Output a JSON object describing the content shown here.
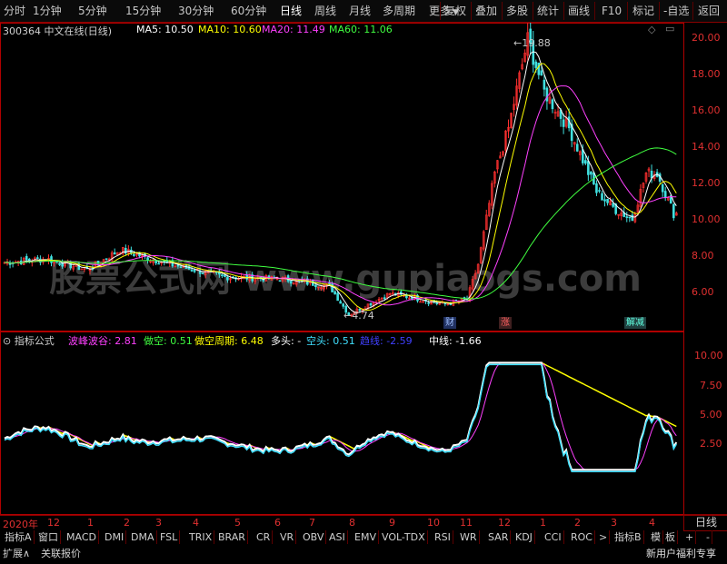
{
  "toolbar": {
    "periods": [
      "分时",
      "1分钟",
      "5分钟",
      "15分钟",
      "30分钟",
      "60分钟",
      "日线",
      "周线",
      "月线",
      "多周期",
      "更多"
    ],
    "active_period": "日线",
    "more_arrow": "▼",
    "actions": [
      "复权",
      "叠加",
      "多股",
      "统计",
      "画线",
      "F10",
      "标记",
      "-自选",
      "返回"
    ]
  },
  "main_header": {
    "stock": "300364 中文在线(日线)",
    "ma5": "MA5: 10.50",
    "ma10": "MA10: 10.60",
    "ma20": "MA20: 11.49",
    "ma60": "MA60: 11.06",
    "icons": [
      "diamond-icon",
      "menu-icon"
    ]
  },
  "main_yaxis": [
    "20.00",
    "18.00",
    "16.00",
    "14.00",
    "12.00",
    "10.00",
    "8.00",
    "6.00"
  ],
  "annotations": {
    "high": "19.88",
    "low": "4.74"
  },
  "event_marks": [
    "财",
    "涨",
    "解减"
  ],
  "watermark": "股票公式网 www.gupiaogs.com",
  "indicator_header": {
    "name": "指标公式",
    "bofeng": "波峰波谷: 2.81",
    "zuokong": "做空: 0.51",
    "zuokong_period": "做空周期: 6.48",
    "duotou": "多头: -",
    "kongtou": "空头: 0.51",
    "zhuixian": "趋线: -2.59",
    "zhongxian": "中线: -1.66"
  },
  "ind_yaxis": [
    "10.00",
    "7.50",
    "5.00",
    "2.50"
  ],
  "date_axis": {
    "start": "2020年",
    "ticks": [
      "12",
      "1",
      "2",
      "3",
      "4",
      "5",
      "6",
      "7",
      "8",
      "9",
      "10",
      "11",
      "12",
      "1",
      "2",
      "3",
      "4"
    ],
    "period": "日线"
  },
  "indicator_tabs": [
    "指标A",
    "窗口",
    "MACD",
    "DMI",
    "DMA",
    "FSL",
    "TRIX",
    "BRAR",
    "CR",
    "VR",
    "OBV",
    "ASI",
    "EMV",
    "VOL-TDX",
    "RSI",
    "WR",
    "SAR",
    "KDJ",
    "CCI",
    "ROC",
    ">",
    "指标B",
    "模",
    "板",
    "+",
    "-"
  ],
  "bottom_tabs": {
    "expand": "扩展∧",
    "quote": "关联报价",
    "promo": "新用户福利专享"
  },
  "colors": {
    "up": "#ff3030",
    "down": "#40e0e0",
    "ma5": "#ffffff",
    "ma10": "#ffff00",
    "ma20": "#ff40ff",
    "ma60": "#40ff40",
    "frame": "#b00000"
  }
}
